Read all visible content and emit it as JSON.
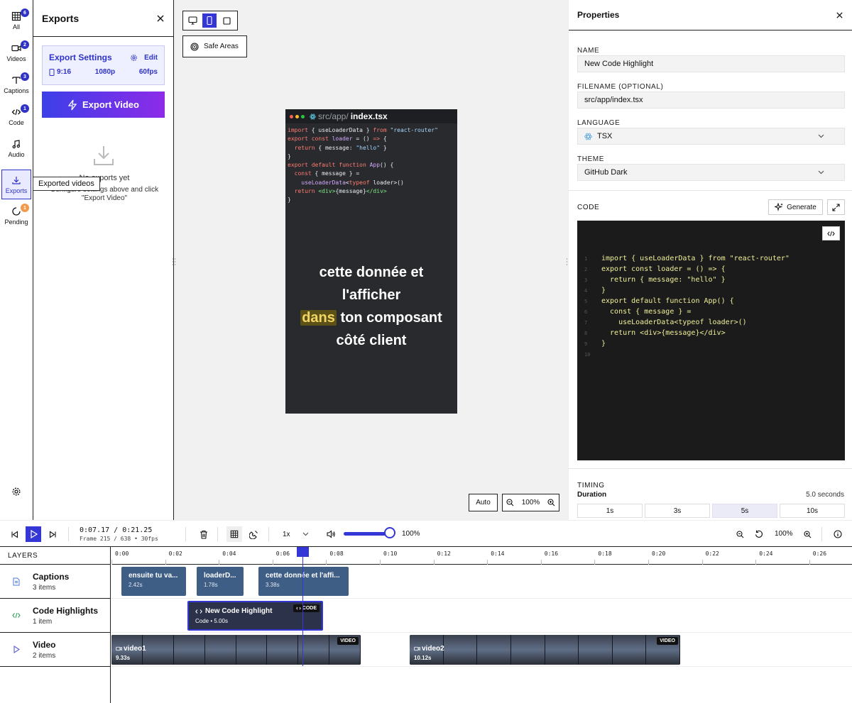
{
  "rail": {
    "items": [
      {
        "label": "All",
        "icon": "grid-icon",
        "badge": "6"
      },
      {
        "label": "Videos",
        "icon": "video-icon",
        "badge": "2"
      },
      {
        "label": "Captions",
        "icon": "text-icon",
        "badge": "3"
      },
      {
        "label": "Code",
        "icon": "code-icon",
        "badge": "1"
      },
      {
        "label": "Audio",
        "icon": "music-icon",
        "badge": ""
      },
      {
        "label": "Exports",
        "icon": "download-icon",
        "badge": ""
      },
      {
        "label": "Pending",
        "icon": "spinner-icon",
        "badge": "1"
      }
    ],
    "tooltip": "Exported videos"
  },
  "exports": {
    "title": "Exports",
    "settings": {
      "title": "Export Settings",
      "edit_label": "Edit",
      "ratio": "9:16",
      "resolution": "1080p",
      "fps": "60fps"
    },
    "export_button": "Export Video",
    "empty_title": "No exports yet",
    "empty_desc_line1": "Configure settings above and click",
    "empty_desc_line2": "\"Export Video\""
  },
  "canvas": {
    "safe_areas_label": "Safe Areas",
    "zoom_auto": "Auto",
    "zoom_value": "100%",
    "preview": {
      "path_prefix": "src/app/",
      "file_name": "index.tsx",
      "caption_before": "cette donnée et l'afficher",
      "caption_highlight": "dans",
      "caption_after": "ton composant côté client"
    }
  },
  "properties": {
    "title": "Properties",
    "name_label": "NAME",
    "name_value": "New Code Highlight",
    "filename_label": "FILENAME (OPTIONAL)",
    "filename_value": "src/app/index.tsx",
    "language_label": "LANGUAGE",
    "language_value": "TSX",
    "theme_label": "THEME",
    "theme_value": "GitHub Dark",
    "code_label": "CODE",
    "generate_label": "Generate",
    "code_lines": [
      "import { useLoaderData } from \"react-router\"",
      "export const loader = () => {",
      "  return { message: \"hello\" }",
      "}",
      "export default function App() {",
      "  const { message } =",
      "    useLoaderData<typeof loader>()",
      "  return <div>{message}</div>",
      "}",
      ""
    ],
    "timing_label": "TIMING",
    "duration_label": "Duration",
    "duration_value": "5.0 seconds",
    "duration_options": [
      "1s",
      "3s",
      "5s",
      "10s"
    ]
  },
  "transport": {
    "time": "0:07.17 / 0:21.25",
    "frame_info": "Frame 215 / 638 • 30fps",
    "speed": "1x",
    "volume": "100%",
    "volume_level": 1.0,
    "timeline_zoom": "100%"
  },
  "timeline": {
    "layers_title": "LAYERS",
    "layers": [
      {
        "name": "Captions",
        "count": "3 items"
      },
      {
        "name": "Code Highlights",
        "count": "1 item"
      },
      {
        "name": "Video",
        "count": "2 items"
      }
    ],
    "ruler_labels": [
      "0:00",
      "0:02",
      "0:04",
      "0:06",
      "0:08",
      "0:10",
      "0:12",
      "0:14",
      "0:16",
      "0:18",
      "0:20",
      "0:22",
      "0:24",
      "0:26"
    ],
    "captions": [
      {
        "name": "ensuite tu va...",
        "duration": "2.42s"
      },
      {
        "name": "loaderD...",
        "duration": "1.78s"
      },
      {
        "name": "cette donnée et l'affi...",
        "duration": "3.38s"
      }
    ],
    "code_clip": {
      "name": "New Code Highlight",
      "meta": "Code • 5.00s",
      "tag": "CODE"
    },
    "videos": [
      {
        "name": "video1",
        "duration": "9.33s",
        "tag": "VIDEO"
      },
      {
        "name": "video2",
        "duration": "10.12s",
        "tag": "VIDEO"
      }
    ]
  },
  "colors": {
    "accent": "#3437d6",
    "caption_clip": "#3e5e86",
    "code_bg": "#1b1b1b"
  }
}
